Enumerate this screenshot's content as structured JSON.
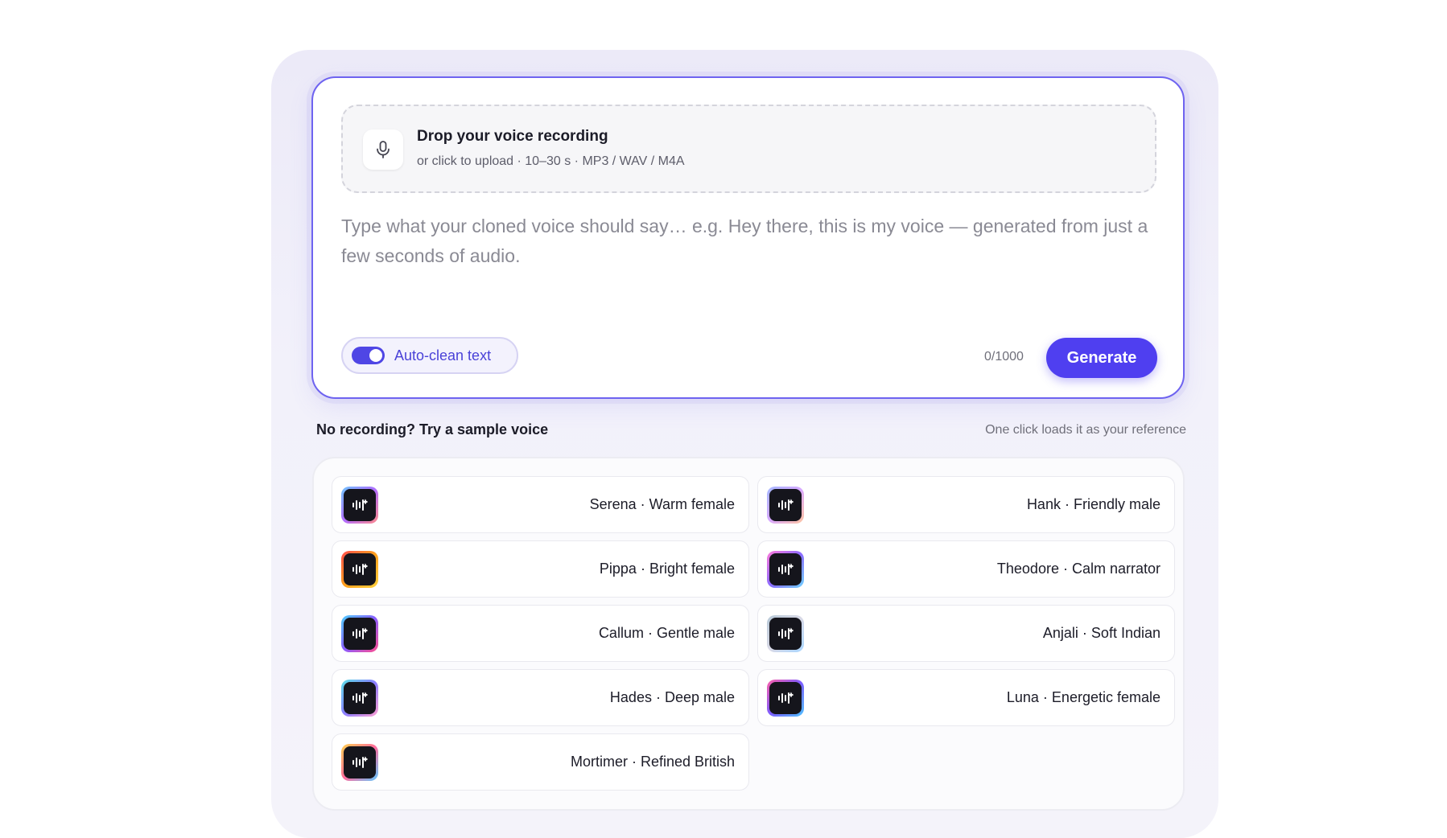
{
  "dropzone": {
    "title": "Drop your voice recording",
    "subtitle": "or click to upload · 10–30 s · MP3 / WAV / M4A",
    "icon": "microphone-icon"
  },
  "text_input": {
    "value": "",
    "placeholder": "Type what your cloned voice should say… e.g. Hey there, this is my voice — generated from just a few seconds of audio."
  },
  "toggle": {
    "label": "Auto-clean text",
    "on": true
  },
  "char_count": "0/1000",
  "generate_label": "Generate",
  "samples": {
    "title": "No recording? Try a sample voice",
    "hint": "One click loads it as your reference",
    "voices": [
      {
        "label": "Serena · Warm female"
      },
      {
        "label": "Hank · Friendly male"
      },
      {
        "label": "Pippa · Bright female"
      },
      {
        "label": "Theodore · Calm narrator"
      },
      {
        "label": "Callum · Gentle male"
      },
      {
        "label": "Anjali · Soft Indian"
      },
      {
        "label": "Hades · Deep male"
      },
      {
        "label": "Luna · Energetic female"
      },
      {
        "label": "Mortimer · Refined British"
      }
    ]
  },
  "colors": {
    "accent": "#4f3ff0",
    "border_accent": "#6e63f0",
    "toggle_text": "#4a42d8"
  }
}
